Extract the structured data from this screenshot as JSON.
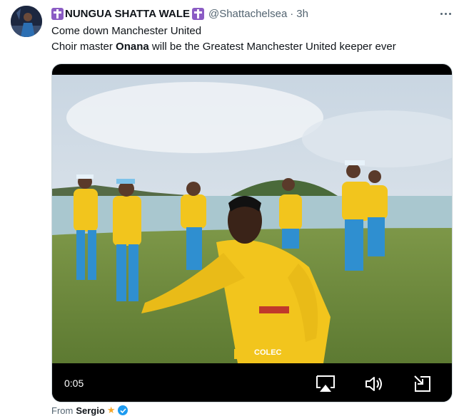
{
  "tweet": {
    "display_name": "NUNGUA SHATTA WALE",
    "handle": "@Shattachelsea",
    "separator": "·",
    "time": "3h",
    "text_line1": "Come down Manchester United",
    "text_line2_pre": "Choir master ",
    "text_line2_bold": "Onana",
    "text_line2_post": " will be the Greatest Manchester United keeper ever",
    "badge_icon": "latin-cross-icon",
    "more_icon": "more-horizontal-icon"
  },
  "video": {
    "timecode": "0:05",
    "jersey_text": "COLEC",
    "controls": [
      "airplay-icon",
      "volume-icon",
      "exit-fullscreen-icon"
    ]
  },
  "source": {
    "from_label": "From",
    "name": "Sergio",
    "star": "★",
    "verified_icon": "verified-badge-icon"
  },
  "colors": {
    "badge_purple": "#8b5cc4",
    "secondary_text": "#536471",
    "verified_blue": "#1d9bf0",
    "jersey_yellow": "#f2c51d"
  }
}
